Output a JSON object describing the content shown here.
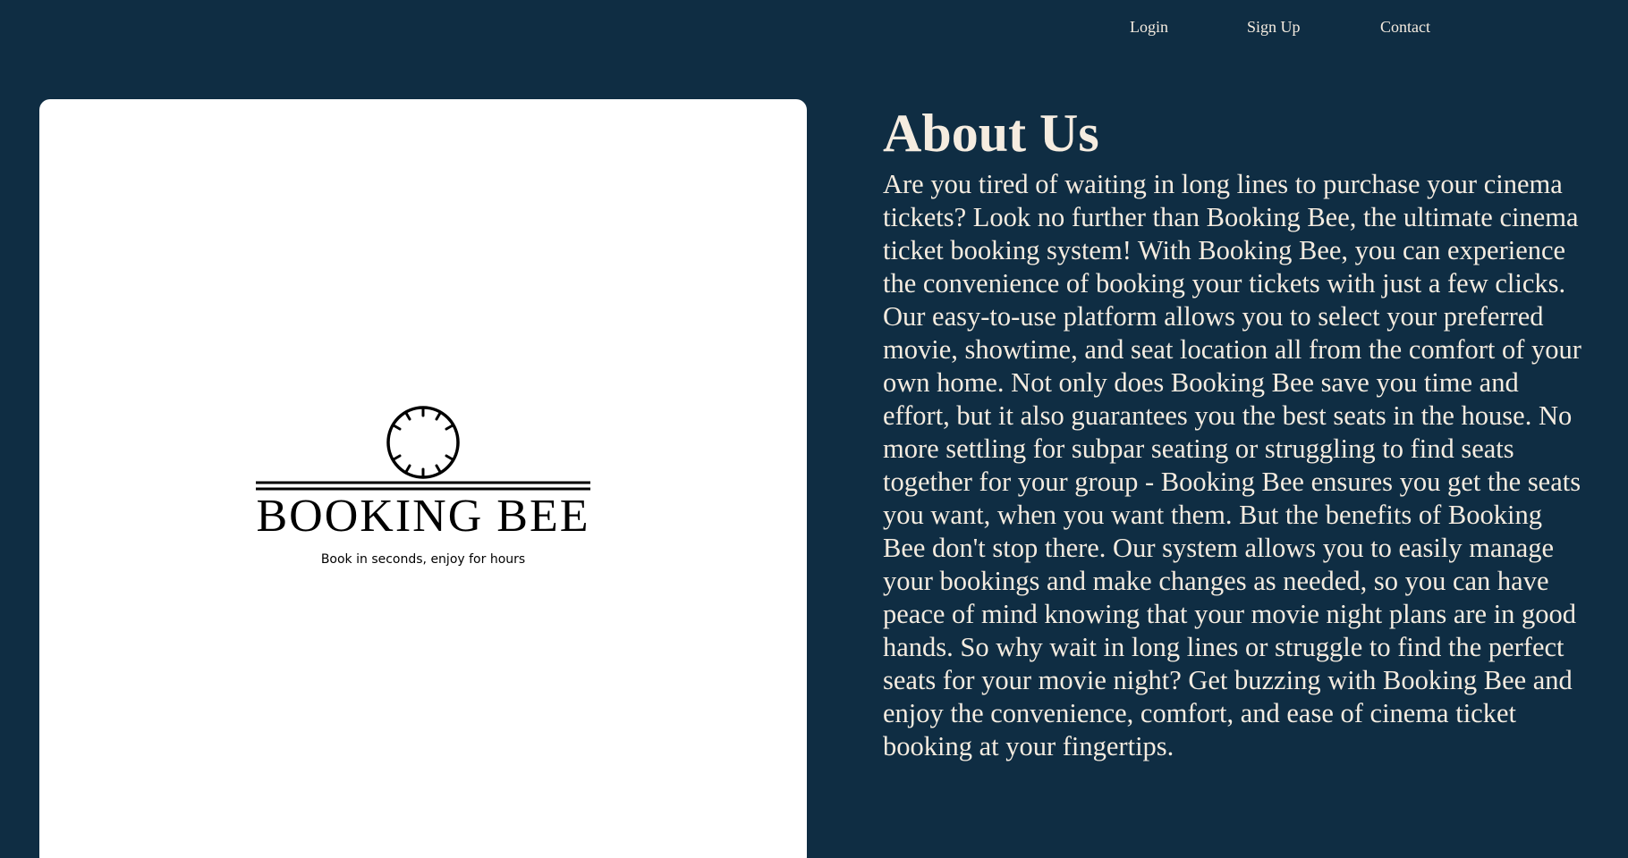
{
  "nav": {
    "login": "Login",
    "signup": "Sign Up",
    "contact": "Contact"
  },
  "logo": {
    "name": "BOOKING BEE",
    "tagline": "Book in seconds, enjoy for hours",
    "icon": "clock-icon"
  },
  "about": {
    "title": "About Us",
    "body": "Are you tired of waiting in long lines to purchase your cinema tickets? Look no further than Booking Bee, the ultimate cinema ticket booking system! With Booking Bee, you can experience the convenience of booking your tickets with just a few clicks. Our easy-to-use platform allows you to select your preferred movie, showtime, and seat location all from the comfort of your own home. Not only does Booking Bee save you time and effort, but it also guarantees you the best seats in the house. No more settling for subpar seating or struggling to find seats together for your group - Booking Bee ensures you get the seats you want, when you want them. But the benefits of Booking Bee don't stop there. Our system allows you to easily manage your bookings and make changes as needed, so you can have peace of mind knowing that your movie night plans are in good hands. So why wait in long lines or struggle to find the perfect seats for your movie night? Get buzzing with Booking Bee and enjoy the convenience, comfort, and ease of cinema ticket booking at your fingertips."
  },
  "colors": {
    "background": "#0f2d43",
    "text": "#f5ece0",
    "card": "#ffffff"
  }
}
